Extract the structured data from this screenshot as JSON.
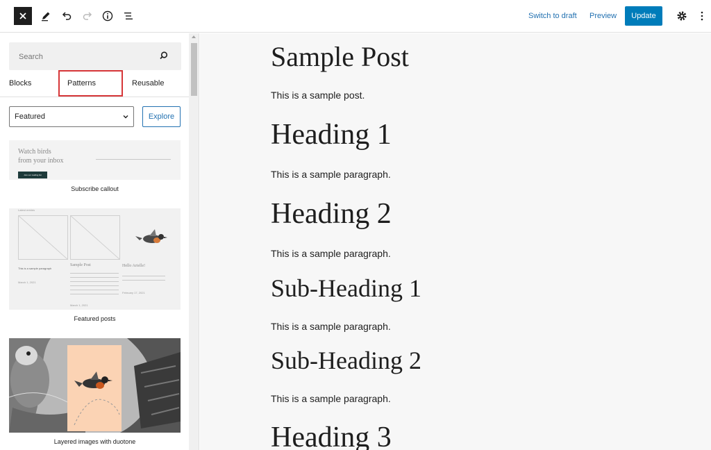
{
  "toolbar": {
    "switch_to_draft": "Switch to draft",
    "preview": "Preview",
    "update": "Update",
    "icons": [
      "close-icon",
      "pencil-icon",
      "undo-icon",
      "redo-icon",
      "info-icon",
      "list-view-icon",
      "gear-icon",
      "more-vertical-icon"
    ]
  },
  "sidebar": {
    "search_placeholder": "Search",
    "tabs": [
      "Blocks",
      "Patterns",
      "Reusable"
    ],
    "category": "Featured",
    "explore": "Explore",
    "patterns": [
      {
        "label": "Subscribe callout",
        "heading_line1": "Watch birds",
        "heading_line2": "from your inbox",
        "button_text": "Join our mailing list"
      },
      {
        "label": "Featured posts",
        "top_label": "Latest entries",
        "col1_title": "This is a sample paragraph",
        "col1_date": "March 1, 2021",
        "col2_title": "Sample Post",
        "col2_date": "March 1, 2021",
        "col3_title": "Hello Arielle!",
        "col3_date": "February 17, 2021"
      },
      {
        "label": "Layered images with duotone"
      }
    ]
  },
  "post": {
    "title": "Sample Post",
    "blocks": [
      {
        "type": "p",
        "text": "This is a sample post."
      },
      {
        "type": "h1",
        "text": "Heading 1"
      },
      {
        "type": "p",
        "text": "This is a sample paragraph."
      },
      {
        "type": "h2",
        "text": "Heading 2"
      },
      {
        "type": "p",
        "text": "This is a sample paragraph."
      },
      {
        "type": "h3",
        "text": "Sub-Heading 1"
      },
      {
        "type": "p",
        "text": "This is a sample paragraph."
      },
      {
        "type": "h3",
        "text": "Sub-Heading 2"
      },
      {
        "type": "p",
        "text": "This is a sample paragraph."
      },
      {
        "type": "h1",
        "text": "Heading 3"
      }
    ]
  },
  "colors": {
    "accent": "#007cba",
    "link": "#2271b1",
    "highlight": "#d63638"
  }
}
